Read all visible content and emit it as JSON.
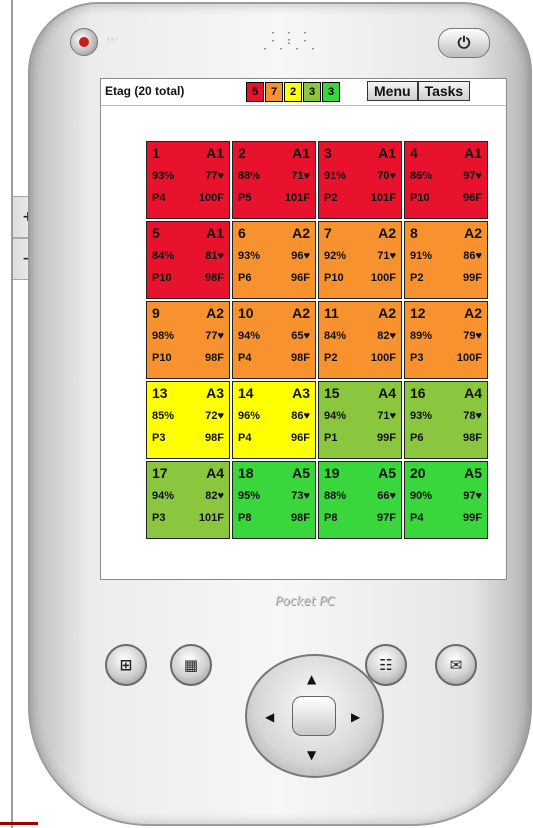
{
  "device": {
    "side_buttons": [
      "+",
      "−"
    ],
    "power_label": "⏻",
    "brand": "Pocket PC"
  },
  "status_bar": {
    "title": "Etag (20 total)",
    "counts": [
      {
        "value": "5",
        "color": "#e8122d"
      },
      {
        "value": "7",
        "color": "#f7922e"
      },
      {
        "value": "2",
        "color": "#ffff00"
      },
      {
        "value": "3",
        "color": "#8bc63f"
      },
      {
        "value": "3",
        "color": "#39d63c"
      }
    ],
    "menu_label": "Menu",
    "tasks_label": "Tasks"
  },
  "tiles": [
    {
      "id": "1",
      "zone": "A1",
      "pct": "93%",
      "hr": "77♥",
      "pos": "P4",
      "temp": "100F",
      "color": "#e8122d"
    },
    {
      "id": "2",
      "zone": "A1",
      "pct": "88%",
      "hr": "71♥",
      "pos": "P5",
      "temp": "101F",
      "color": "#e8122d"
    },
    {
      "id": "3",
      "zone": "A1",
      "pct": "91%",
      "hr": "70♥",
      "pos": "P2",
      "temp": "101F",
      "color": "#e8122d"
    },
    {
      "id": "4",
      "zone": "A1",
      "pct": "86%",
      "hr": "97♥",
      "pos": "P10",
      "temp": "96F",
      "color": "#e8122d"
    },
    {
      "id": "5",
      "zone": "A1",
      "pct": "84%",
      "hr": "81♥",
      "pos": "P10",
      "temp": "98F",
      "color": "#e8122d"
    },
    {
      "id": "6",
      "zone": "A2",
      "pct": "93%",
      "hr": "96♥",
      "pos": "P6",
      "temp": "96F",
      "color": "#f7922e"
    },
    {
      "id": "7",
      "zone": "A2",
      "pct": "92%",
      "hr": "71♥",
      "pos": "P10",
      "temp": "100F",
      "color": "#f7922e"
    },
    {
      "id": "8",
      "zone": "A2",
      "pct": "91%",
      "hr": "86♥",
      "pos": "P2",
      "temp": "99F",
      "color": "#f7922e"
    },
    {
      "id": "9",
      "zone": "A2",
      "pct": "98%",
      "hr": "77♥",
      "pos": "P10",
      "temp": "98F",
      "color": "#f7922e"
    },
    {
      "id": "10",
      "zone": "A2",
      "pct": "94%",
      "hr": "65♥",
      "pos": "P4",
      "temp": "98F",
      "color": "#f7922e"
    },
    {
      "id": "11",
      "zone": "A2",
      "pct": "84%",
      "hr": "82♥",
      "pos": "P2",
      "temp": "100F",
      "color": "#f7922e"
    },
    {
      "id": "12",
      "zone": "A2",
      "pct": "89%",
      "hr": "79♥",
      "pos": "P3",
      "temp": "100F",
      "color": "#f7922e"
    },
    {
      "id": "13",
      "zone": "A3",
      "pct": "85%",
      "hr": "72♥",
      "pos": "P3",
      "temp": "98F",
      "color": "#ffff00"
    },
    {
      "id": "14",
      "zone": "A3",
      "pct": "96%",
      "hr": "86♥",
      "pos": "P4",
      "temp": "96F",
      "color": "#ffff00"
    },
    {
      "id": "15",
      "zone": "A4",
      "pct": "94%",
      "hr": "71♥",
      "pos": "P1",
      "temp": "99F",
      "color": "#8bc63f"
    },
    {
      "id": "16",
      "zone": "A4",
      "pct": "93%",
      "hr": "78♥",
      "pos": "P6",
      "temp": "98F",
      "color": "#8bc63f"
    },
    {
      "id": "17",
      "zone": "A4",
      "pct": "94%",
      "hr": "82♥",
      "pos": "P3",
      "temp": "101F",
      "color": "#8bc63f"
    },
    {
      "id": "18",
      "zone": "A5",
      "pct": "95%",
      "hr": "73♥",
      "pos": "P8",
      "temp": "98F",
      "color": "#39d63c"
    },
    {
      "id": "19",
      "zone": "A5",
      "pct": "88%",
      "hr": "66♥",
      "pos": "P8",
      "temp": "97F",
      "color": "#39d63c"
    },
    {
      "id": "20",
      "zone": "A5",
      "pct": "90%",
      "hr": "97♥",
      "pos": "P4",
      "temp": "99F",
      "color": "#39d63c"
    }
  ],
  "hardware_buttons": [
    {
      "name": "start-icon",
      "glyph": "⊞"
    },
    {
      "name": "calendar-icon",
      "glyph": "▦"
    },
    {
      "name": "contacts-icon",
      "glyph": "☷"
    },
    {
      "name": "inbox-icon",
      "glyph": "✉"
    }
  ],
  "dpad_arrows": {
    "up": "▲",
    "down": "▼",
    "left": "◀",
    "right": "▶"
  }
}
